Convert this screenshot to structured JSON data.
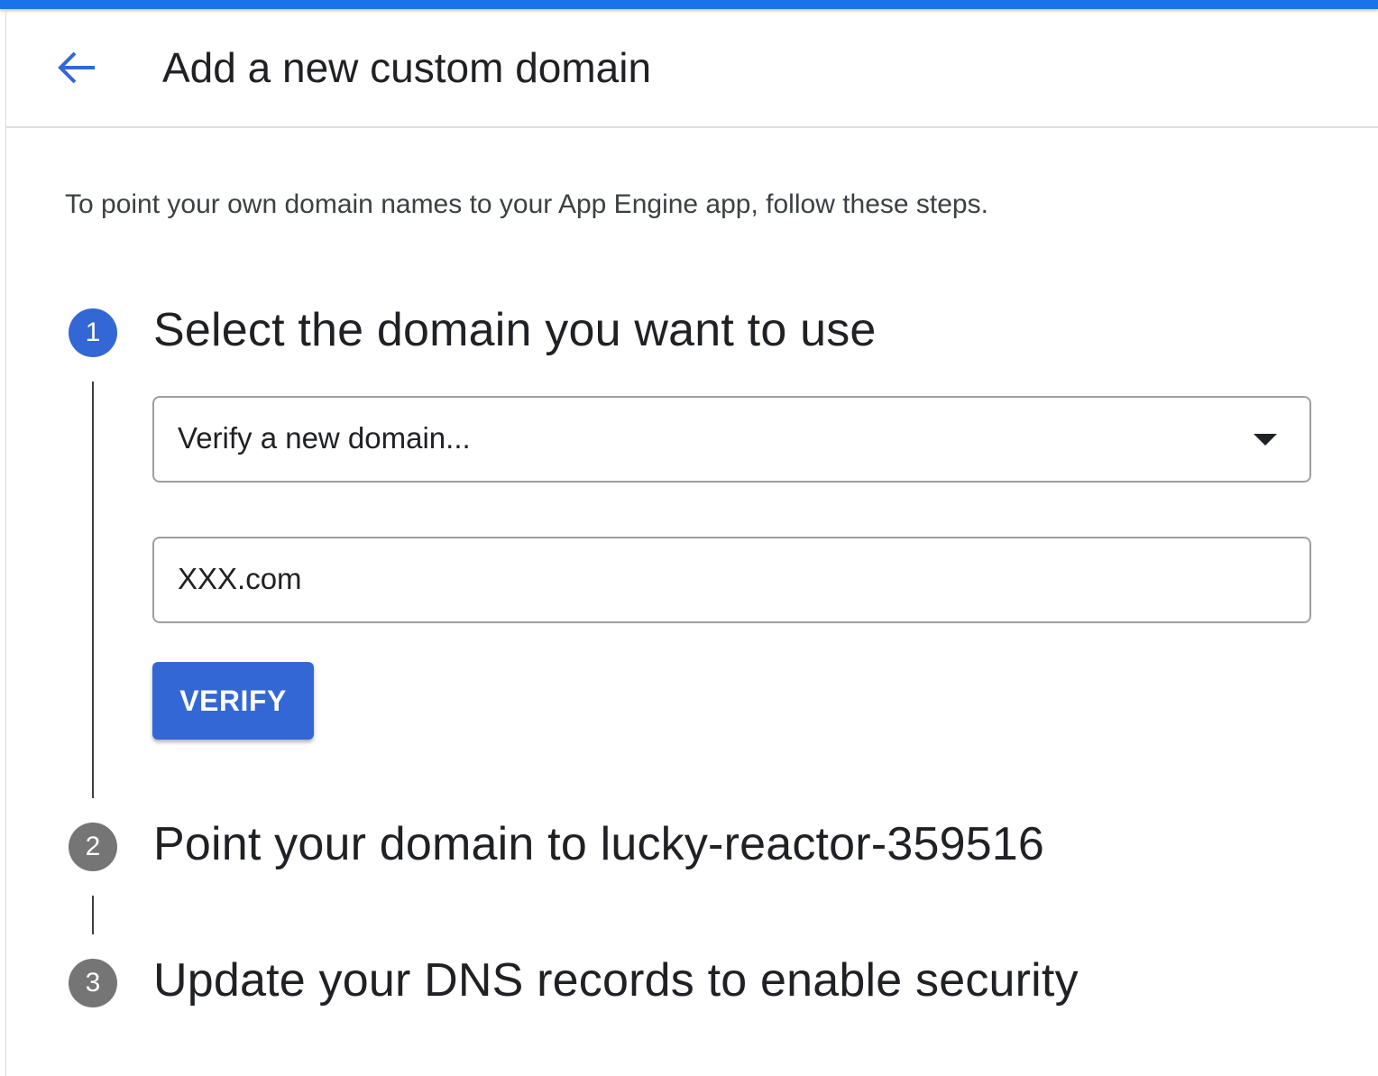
{
  "header": {
    "back_icon": "arrow-back-icon",
    "title": "Add a new custom domain"
  },
  "intro_text": "To point your own domain names to your App Engine app, follow these steps.",
  "steps": [
    {
      "number": "1",
      "title": "Select the domain you want to use",
      "state": "active"
    },
    {
      "number": "2",
      "title": "Point your domain to lucky-reactor-359516",
      "state": "inactive"
    },
    {
      "number": "3",
      "title": "Update your DNS records to enable security",
      "state": "inactive"
    }
  ],
  "domain_select": {
    "selected": "Verify a new domain...",
    "caret_icon": "dropdown-caret-icon"
  },
  "domain_input": {
    "value": "XXX.com"
  },
  "verify_button": {
    "label": "VERIFY"
  },
  "colors": {
    "accent": "#3367d6",
    "top_bar": "#1a73e8",
    "inactive_step": "#757575"
  }
}
